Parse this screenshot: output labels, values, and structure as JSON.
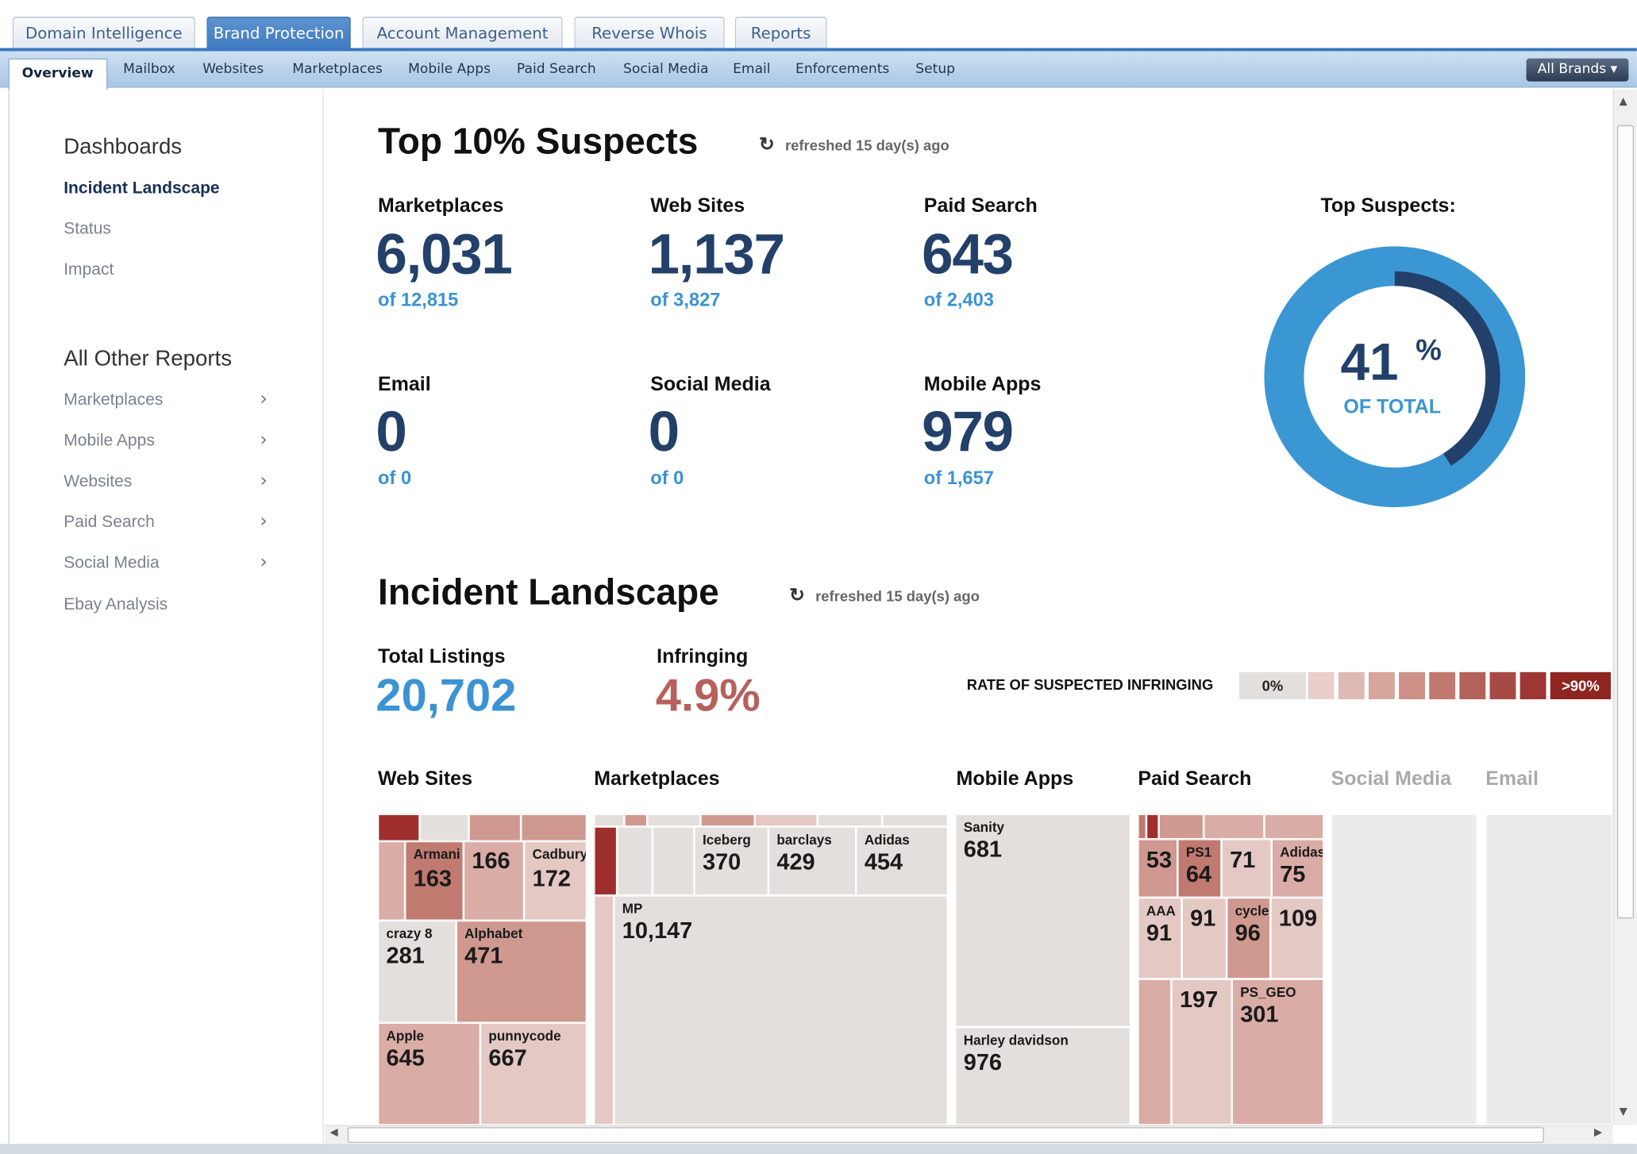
{
  "top_tabs": [
    "Domain Intelligence",
    "Brand Protection",
    "Account Management",
    "Reverse Whois",
    "Reports"
  ],
  "sub_nav": [
    "Overview",
    "Mailbox",
    "Websites",
    "Marketplaces",
    "Mobile Apps",
    "Paid Search",
    "Social Media",
    "Email",
    "Enforcements",
    "Setup"
  ],
  "brand_select": "All Brands",
  "sidebar": {
    "dashboards_heading": "Dashboards",
    "dashboards": [
      "Incident Landscape",
      "Status",
      "Impact"
    ],
    "reports_heading": "All Other Reports",
    "reports": [
      "Marketplaces",
      "Mobile Apps",
      "Websites",
      "Paid Search",
      "Social Media",
      "Ebay Analysis"
    ]
  },
  "top_suspects": {
    "title": "Top 10% Suspects",
    "refreshed": "refreshed 15 day(s) ago",
    "metrics": [
      {
        "label": "Marketplaces",
        "value": "6,031",
        "of": "of 12,815"
      },
      {
        "label": "Web Sites",
        "value": "1,137",
        "of": "of 3,827"
      },
      {
        "label": "Paid Search",
        "value": "643",
        "of": "of 2,403"
      },
      {
        "label": "Email",
        "value": "0",
        "of": "of 0"
      },
      {
        "label": "Social Media",
        "value": "0",
        "of": "of 0"
      },
      {
        "label": "Mobile Apps",
        "value": "979",
        "of": "of 1,657"
      }
    ],
    "donut_title": "Top Suspects:",
    "donut_value": "41",
    "donut_unit": "%",
    "donut_caption": "OF TOTAL",
    "donut_fraction": 0.41,
    "colors": {
      "ring": "#3b96d4",
      "arc": "#23406a"
    }
  },
  "incident": {
    "title": "Incident Landscape",
    "refreshed": "refreshed 15 day(s) ago",
    "total_label": "Total Listings",
    "total_value": "20,702",
    "infringing_label": "Infringing",
    "infringing_value": "4.9%",
    "scale_label": "RATE OF SUSPECTED INFRINGING",
    "scale_min": "0%",
    "scale_max": ">90%",
    "columns": [
      "Web Sites",
      "Marketplaces",
      "Mobile Apps",
      "Paid Search",
      "Social Media",
      "Email"
    ],
    "tiles": {
      "armani": {
        "label": "Armani",
        "value": "163"
      },
      "t166": {
        "value": "166"
      },
      "cadbury": {
        "label": "Cadbury",
        "value": "172"
      },
      "crazy8": {
        "label": "crazy 8",
        "value": "281"
      },
      "alphabet": {
        "label": "Alphabet",
        "value": "471"
      },
      "apple": {
        "label": "Apple",
        "value": "645"
      },
      "punnycode": {
        "label": "punnycode",
        "value": "667"
      },
      "iceberg": {
        "label": "Iceberg",
        "value": "370"
      },
      "barclays": {
        "label": "barclays",
        "value": "429"
      },
      "adidas_mp": {
        "label": "Adidas",
        "value": "454"
      },
      "mp": {
        "label": "MP",
        "value": "10,147"
      },
      "sanity": {
        "label": "Sanity",
        "value": "681"
      },
      "harley": {
        "label": "Harley davidson",
        "value": "976"
      },
      "t53": {
        "value": "53"
      },
      "ps1": {
        "label": "PS1",
        "value": "64"
      },
      "t71": {
        "value": "71"
      },
      "adidas_ps": {
        "label": "Adidas",
        "value": "75"
      },
      "aaa": {
        "label": "AAA",
        "value": "91"
      },
      "t91": {
        "value": "91"
      },
      "cycle": {
        "label": "cycle",
        "value": "96"
      },
      "t109": {
        "value": "109"
      },
      "t197": {
        "value": "197"
      },
      "psgeo": {
        "label": "PS_GEO",
        "value": "301"
      }
    }
  }
}
